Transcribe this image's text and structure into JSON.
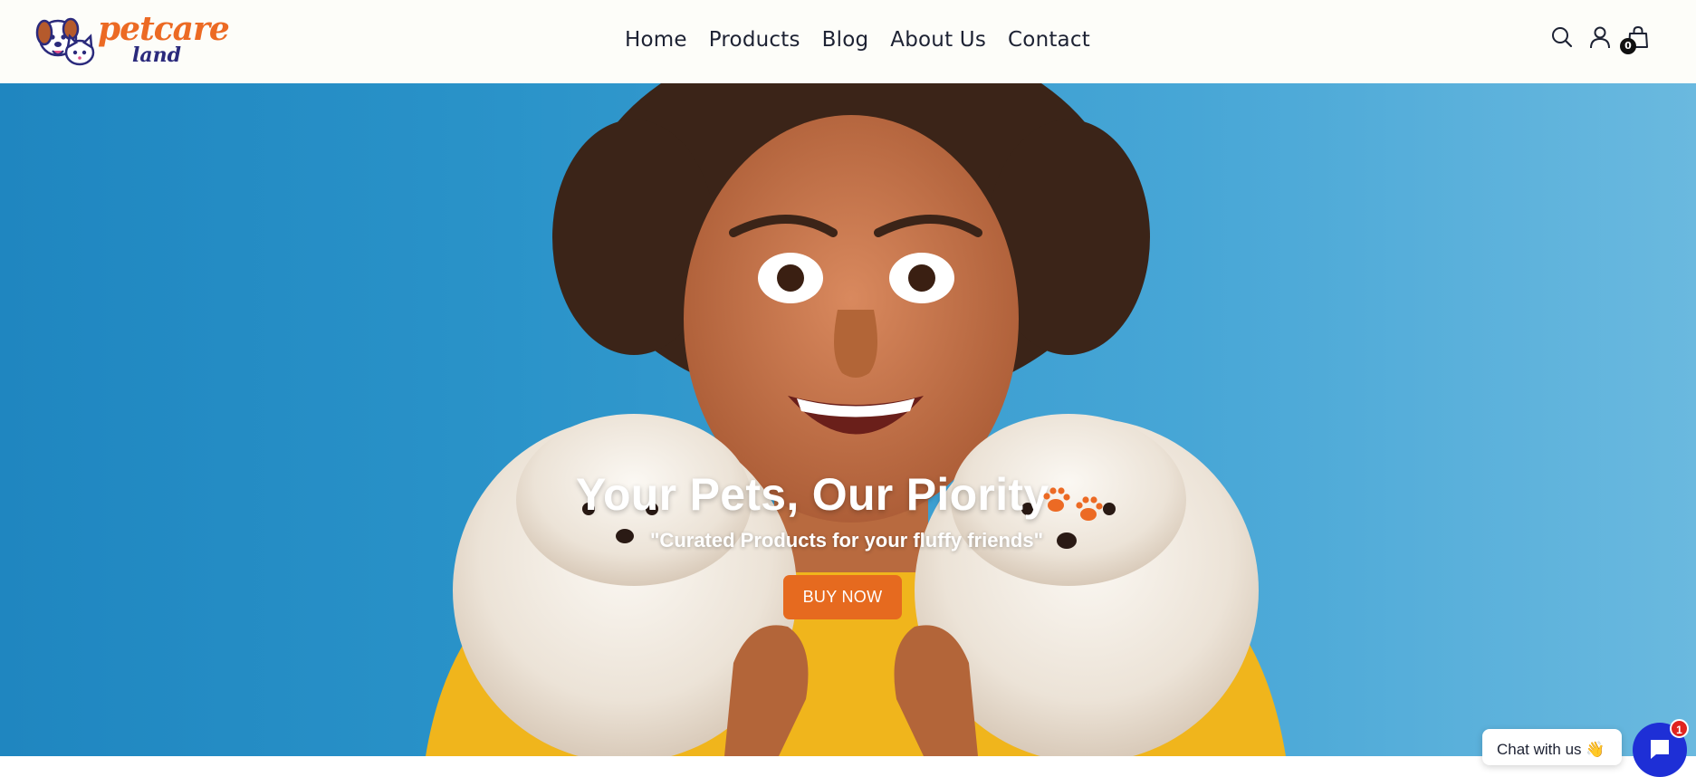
{
  "brand": {
    "logo_text_primary": "petcare",
    "logo_text_secondary": "land",
    "logo_icon": "dog-and-cat-mascot-icon",
    "accent_color": "#ec6a24",
    "secondary_color": "#2b2a7c"
  },
  "nav": {
    "items": [
      {
        "label": "Home"
      },
      {
        "label": "Products"
      },
      {
        "label": "Blog"
      },
      {
        "label": "About Us"
      },
      {
        "label": "Contact"
      }
    ]
  },
  "header_icons": {
    "search_icon": "search-icon",
    "account_icon": "account-icon",
    "cart_icon": "shopping-bag-icon",
    "cart_count": "0"
  },
  "hero": {
    "title": "Your Pets, Our Piority",
    "title_icon": "paw-prints-icon",
    "subtitle": "\"Curated Products for your fluffy friends\"",
    "cta_label": "BUY NOW",
    "cta_color": "#e66a1f",
    "background_color": "#2a93c9"
  },
  "chat": {
    "prompt_label": "Chat with us 👋",
    "launcher_icon": "chat-icon",
    "unread_count": "1",
    "launcher_color": "#1e2fd6"
  }
}
